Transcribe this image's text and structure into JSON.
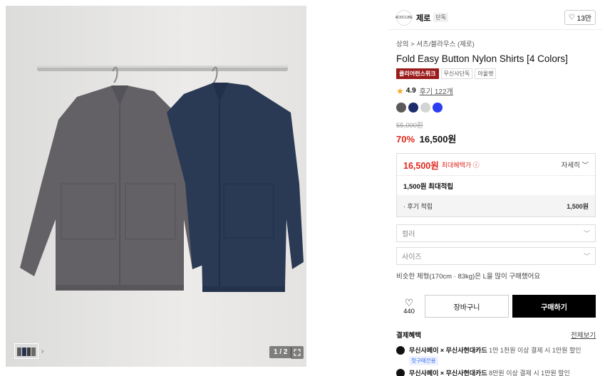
{
  "gallery": {
    "counter": "1 / 2",
    "thumb_colors": [
      "#5d5b5e",
      "#253551",
      "#3a3a3a",
      "#6a6a6a"
    ]
  },
  "brand": {
    "logo_text": "ADDCUBE",
    "name": "제로",
    "tag": "단독"
  },
  "favorite": {
    "count": "13만"
  },
  "breadcrumb": "상의 > 셔츠/블라우스 (제로)",
  "product": {
    "title": "Fold Easy Button Nylon Shirts [4 Colors]",
    "badges": [
      "클리어런스위크",
      "무신사단독",
      "아울렛"
    ],
    "rating": "4.9",
    "reviews": "후기 122개",
    "colors": [
      "#5a5a5a",
      "#1d2c6b",
      "#d4d4d4",
      "#2b3ef0"
    ],
    "original_price": "55,000원",
    "discount": "70%",
    "price": "16,500원"
  },
  "benefit": {
    "best_price": "16,500원",
    "best_label": "최대혜택가 ⓘ",
    "detail": "자세히 ﹀",
    "points": "1,500원 최대적립",
    "review_label": "· 후기 적립",
    "review_amount": "1,500원"
  },
  "options": {
    "color_placeholder": "컬러",
    "size_placeholder": "사이즈"
  },
  "hint": "비슷한 체형(170cm · 83kg)은 L을 많이 구매했어요",
  "buy": {
    "like_count": "440",
    "cart_label": "장바구니",
    "order_label": "구매하기"
  },
  "payment": {
    "title": "결제혜택",
    "more": "전체보기",
    "items": [
      {
        "bold": "무신사페이 × 무신사현대카드",
        "text": " 1만 1천원 이상 결제 시 1만원 할인",
        "tag": "첫구매전용"
      },
      {
        "bold": "무신사페이 × 무신사현대카드",
        "text": " 8만원 이상 결제 시 1만원 할인",
        "tag": ""
      }
    ]
  }
}
